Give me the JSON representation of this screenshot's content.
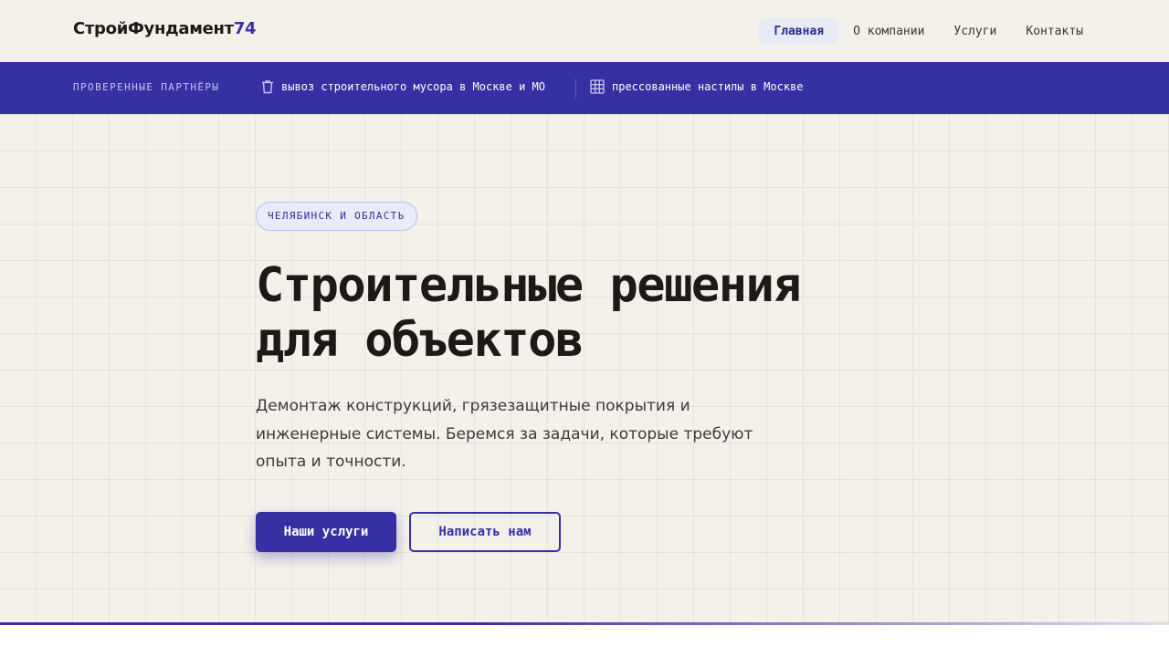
{
  "header": {
    "logo_text": "СтройФундамент",
    "logo_suffix": "74",
    "nav": [
      {
        "label": "Главная",
        "active": true
      },
      {
        "label": "О компании",
        "active": false
      },
      {
        "label": "Услуги",
        "active": false
      },
      {
        "label": "Контакты",
        "active": false
      }
    ]
  },
  "partners": {
    "title": "ПРОВЕРЕННЫЕ ПАРТНЁРЫ",
    "items": [
      {
        "icon": "trash-icon",
        "label": "вывоз строительного мусора в Москве и МО"
      },
      {
        "icon": "grid-icon",
        "label": "прессованные настилы в Москве"
      }
    ]
  },
  "hero": {
    "badge": "ЧЕЛЯБИНСК И ОБЛАСТЬ",
    "title_line1": "Строительные решения",
    "title_line2": "для объектов",
    "subtitle": "Демонтаж конструкций, грязезащитные покрытия и инженерные системы. Беремся за задачи, которые требуют опыта и точности.",
    "primary_button": "Наши услуги",
    "secondary_button": "Написать нам"
  },
  "colors": {
    "accent": "#3730a3",
    "background": "#f4f0ea",
    "text": "#1c1a17"
  }
}
